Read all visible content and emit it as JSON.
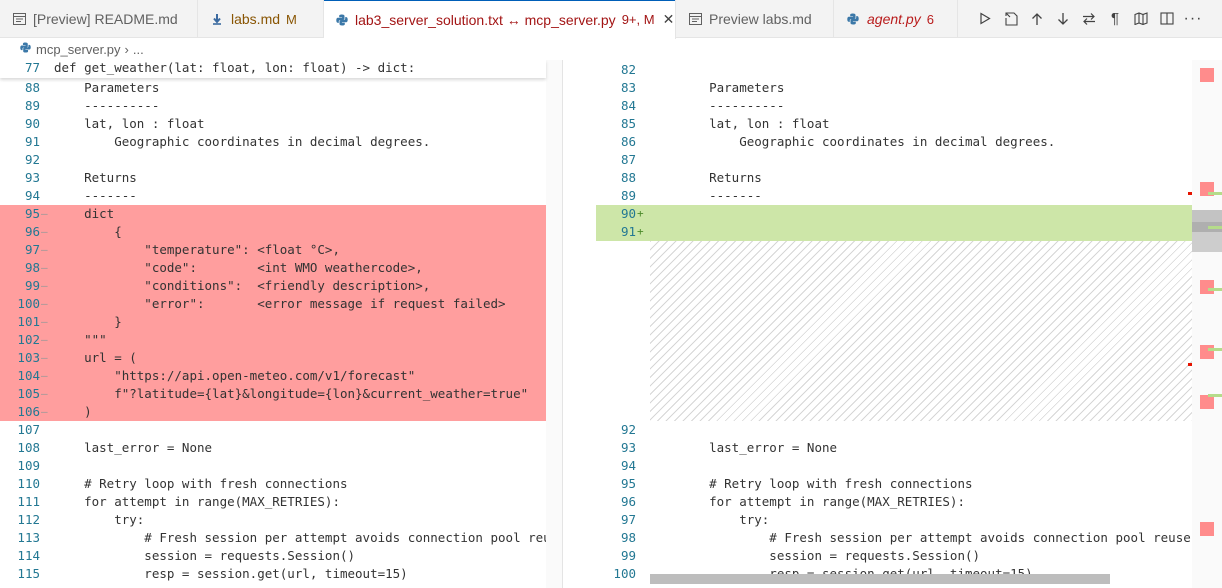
{
  "tabs": [
    {
      "label": "[Preview] README.md",
      "icon": "preview-icon",
      "badge": "",
      "italic": false,
      "active": false
    },
    {
      "label": "labs.md",
      "icon": "markdown-icon",
      "badge": "M",
      "italic": false,
      "active": false
    },
    {
      "label": "lab3_server_solution.txt ↔ mcp_server.py",
      "icon": "python-icon",
      "badge": "9+, M",
      "italic": false,
      "active": true
    },
    {
      "label": "Preview labs.md",
      "icon": "preview-icon",
      "badge": "",
      "italic": false,
      "active": false
    },
    {
      "label": "agent.py",
      "icon": "python-icon",
      "badge": "6",
      "italic": true,
      "active": false
    }
  ],
  "tab_close": "✕",
  "actions": [
    "run-icon",
    "open-file-icon",
    "arrow-up-icon",
    "arrow-down-icon",
    "swap-icon",
    "pilcrow-icon",
    "map-icon",
    "split-editor-icon",
    "more-icon"
  ],
  "breadcrumb": {
    "file": "mcp_server.py",
    "more": "..."
  },
  "left": {
    "sticky": {
      "num": "77",
      "text": "def get_weather(lat: float, lon: float) -> dict:"
    },
    "lines": [
      {
        "num": "88",
        "text": "    Parameters",
        "kind": ""
      },
      {
        "num": "89",
        "text": "    ----------",
        "kind": ""
      },
      {
        "num": "90",
        "text": "    lat, lon : float",
        "kind": ""
      },
      {
        "num": "91",
        "text": "        Geographic coordinates in decimal degrees.",
        "kind": ""
      },
      {
        "num": "92",
        "text": "",
        "kind": ""
      },
      {
        "num": "93",
        "text": "    Returns",
        "kind": ""
      },
      {
        "num": "94",
        "text": "    -------",
        "kind": ""
      },
      {
        "num": "95",
        "text": "    dict",
        "kind": "del"
      },
      {
        "num": "96",
        "text": "        {",
        "kind": "del"
      },
      {
        "num": "97",
        "text": "            \"temperature\": <float °C>,",
        "kind": "del"
      },
      {
        "num": "98",
        "text": "            \"code\":        <int WMO weathercode>,",
        "kind": "del"
      },
      {
        "num": "99",
        "text": "            \"conditions\":  <friendly description>,",
        "kind": "del"
      },
      {
        "num": "100",
        "text": "            \"error\":       <error message if request failed>",
        "kind": "del"
      },
      {
        "num": "101",
        "text": "        }",
        "kind": "del"
      },
      {
        "num": "102",
        "text": "    \"\"\"",
        "kind": "del"
      },
      {
        "num": "103",
        "text": "    url = (",
        "kind": "del"
      },
      {
        "num": "104",
        "text": "        \"https://api.open-meteo.com/v1/forecast\"",
        "kind": "del"
      },
      {
        "num": "105",
        "text": "        f\"?latitude={lat}&longitude={lon}&current_weather=true\"",
        "kind": "del"
      },
      {
        "num": "106",
        "text": "    )",
        "kind": "del"
      },
      {
        "num": "107",
        "text": "",
        "kind": ""
      },
      {
        "num": "108",
        "text": "    last_error = None",
        "kind": ""
      },
      {
        "num": "109",
        "text": "",
        "kind": ""
      },
      {
        "num": "110",
        "text": "    # Retry loop with fresh connections",
        "kind": ""
      },
      {
        "num": "111",
        "text": "    for attempt in range(MAX_RETRIES):",
        "kind": ""
      },
      {
        "num": "112",
        "text": "        try:",
        "kind": ""
      },
      {
        "num": "113",
        "text": "            # Fresh session per attempt avoids connection pool reuse is",
        "kind": ""
      },
      {
        "num": "114",
        "text": "            session = requests.Session()",
        "kind": ""
      },
      {
        "num": "115",
        "text": "            resp = session.get(url, timeout=15)",
        "kind": ""
      }
    ]
  },
  "right": {
    "lines_top": [
      {
        "num": "82",
        "text": "",
        "kind": ""
      },
      {
        "num": "83",
        "text": "    Parameters",
        "kind": ""
      },
      {
        "num": "84",
        "text": "    ----------",
        "kind": ""
      },
      {
        "num": "85",
        "text": "    lat, lon : float",
        "kind": ""
      },
      {
        "num": "86",
        "text": "        Geographic coordinates in decimal degrees.",
        "kind": ""
      },
      {
        "num": "87",
        "text": "",
        "kind": ""
      },
      {
        "num": "88",
        "text": "    Returns",
        "kind": ""
      },
      {
        "num": "89",
        "text": "    -------",
        "kind": ""
      },
      {
        "num": "90",
        "text": "",
        "kind": "ins"
      },
      {
        "num": "91",
        "text": "",
        "kind": "ins"
      }
    ],
    "lines_bottom": [
      {
        "num": "92",
        "text": "",
        "kind": ""
      },
      {
        "num": "93",
        "text": "    last_error = None",
        "kind": ""
      },
      {
        "num": "94",
        "text": "",
        "kind": ""
      },
      {
        "num": "95",
        "text": "    # Retry loop with fresh connections",
        "kind": ""
      },
      {
        "num": "96",
        "text": "    for attempt in range(MAX_RETRIES):",
        "kind": ""
      },
      {
        "num": "97",
        "text": "        try:",
        "kind": ""
      },
      {
        "num": "98",
        "text": "            # Fresh session per attempt avoids connection pool reuse issues",
        "kind": ""
      },
      {
        "num": "99",
        "text": "            session = requests.Session()",
        "kind": ""
      },
      {
        "num": "100",
        "text": "            resp = session.get(url, timeout=15)",
        "kind": ""
      }
    ],
    "insert_marker": "+"
  },
  "colors": {
    "accent": "#005fb8",
    "deleted": "#ff9e9e",
    "inserted": "#cde6a8",
    "modified_badge": "#895503",
    "error_badge": "#b91c1c"
  }
}
